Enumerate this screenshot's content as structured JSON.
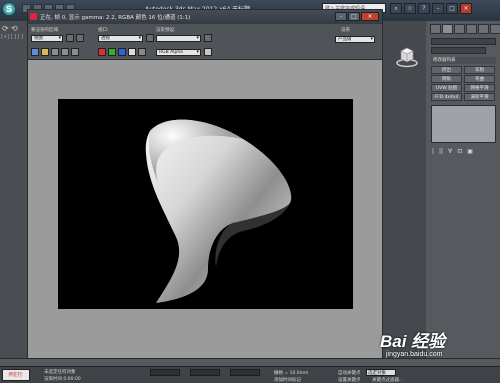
{
  "app": {
    "title": "Autodesk 3ds Max  2012 x64    无标题",
    "search_placeholder": "键入关键字或短语",
    "logo_letter": "S"
  },
  "left_strip": {
    "tabs_label": "[+] [ ] [ ]"
  },
  "frame_window": {
    "title": "正在, 帧 0, 显示 gamma: 2.2, RGBA 颜色 16 位/通道 (1:1)",
    "labels": {
      "area_to_render": "要渲染的区域:",
      "viewport": "视口:",
      "render_preset": "渲染预设:",
      "render": "渲染"
    },
    "dropdowns": {
      "area": "视图",
      "viewport": "透视",
      "preset": "",
      "render_mode": "产品级",
      "channel": "RGB Alpha"
    }
  },
  "command_panel": {
    "header_modifier_list": "修改器列表",
    "buttons": [
      "挤出",
      "车削",
      "倒角",
      "弯曲",
      "UVW 贴图",
      "网格平滑",
      "FFD 4x4x4",
      "涡轮平滑"
    ],
    "tools": [
      "|",
      "||",
      "∀",
      "⊡",
      "▣"
    ]
  },
  "status": {
    "left_button": "所在行:",
    "selected": "未选定任何对象",
    "render_time": "渲染时间 0:00:00",
    "grid": "栅格 = 10.0mm",
    "auto_key": "自动关键点",
    "set_key": "设置关键点",
    "selected_label": "选定对象",
    "key_filter": "关键点过滤器...",
    "add_time_tag": "添加时间标记"
  },
  "watermark": {
    "brand": "Bai 经验",
    "url": "jingyan.baidu.com"
  },
  "colors": {
    "render_bg": "#000000",
    "object_fill": "#e8e8e8",
    "frame_bg": "#9b9b9b",
    "ui_dark": "#44484d"
  }
}
